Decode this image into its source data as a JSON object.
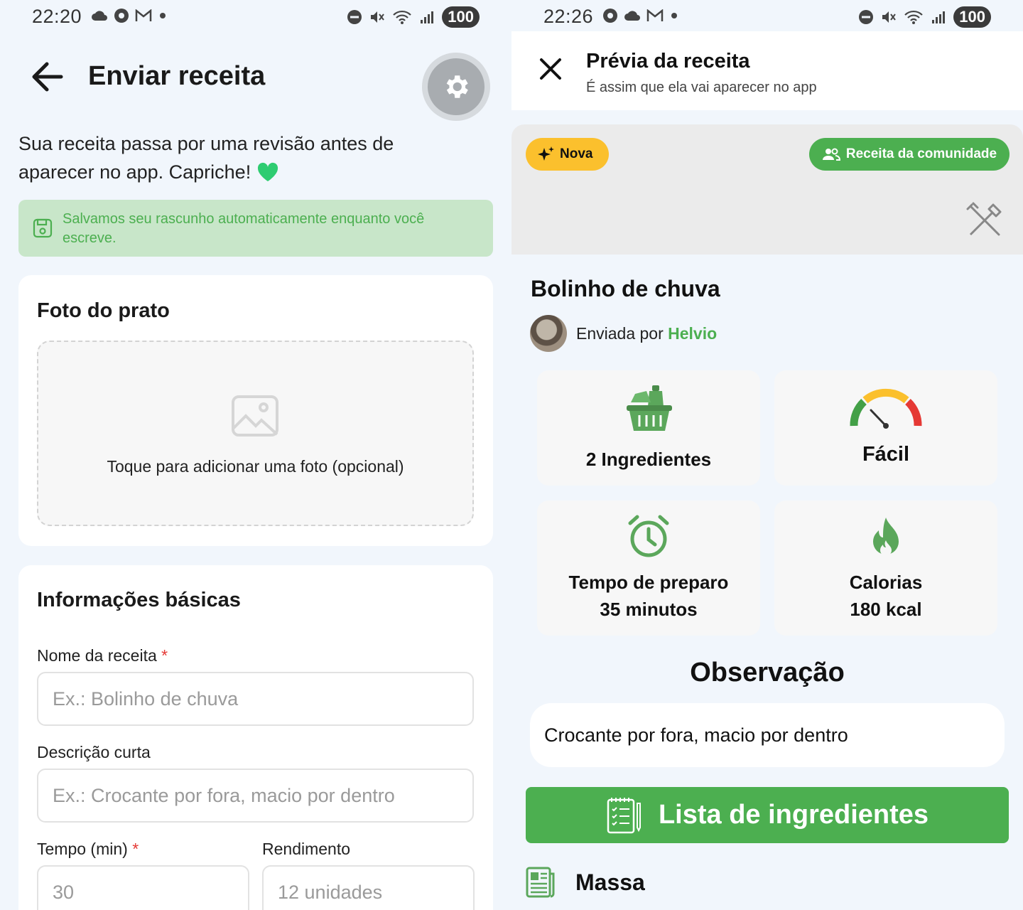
{
  "left": {
    "status": {
      "time": "22:20",
      "battery": "100"
    },
    "header": {
      "title": "Enviar receita"
    },
    "intro": "Sua receita passa por uma revisão antes de aparecer no app. Capriche!",
    "notice": "Salvamos seu rascunho automaticamente enquanto você escreve.",
    "photo_card": {
      "title": "Foto do prato",
      "hint": "Toque para adicionar uma foto (opcional)"
    },
    "basic_card": {
      "title": "Informações básicas",
      "name_label": "Nome da receita",
      "name_placeholder": "Ex.: Bolinho de chuva",
      "desc_label": "Descrição curta",
      "desc_placeholder": "Ex.: Crocante por fora, macio por dentro",
      "time_label": "Tempo (min)",
      "time_placeholder": "30",
      "yield_label": "Rendimento",
      "yield_placeholder": "12 unidades",
      "required_mark": "*"
    }
  },
  "right": {
    "status": {
      "time": "22:26",
      "battery": "100"
    },
    "header": {
      "title": "Prévia da receita",
      "subtitle": "É assim que ela vai aparecer no app"
    },
    "badges": {
      "new": "Nova",
      "community": "Receita da comunidade"
    },
    "recipe": {
      "name": "Bolinho de chuva",
      "author_prefix": "Enviada por",
      "author_name": "Helvio"
    },
    "stats": {
      "ingredients": "2  Ingredientes",
      "difficulty": "Fácil",
      "time_label": "Tempo de preparo",
      "time_value": "35 minutos",
      "calories_label": "Calorias",
      "calories_value": "180 kcal"
    },
    "observation": {
      "title": "Observação",
      "text": "Crocante por fora, macio por dentro"
    },
    "ingredients_button": "Lista de ingredientes",
    "section": "Massa"
  },
  "colors": {
    "accent": "#4caf50",
    "badge_yellow": "#fbc02d",
    "notice_bg": "#c8e6c9"
  }
}
